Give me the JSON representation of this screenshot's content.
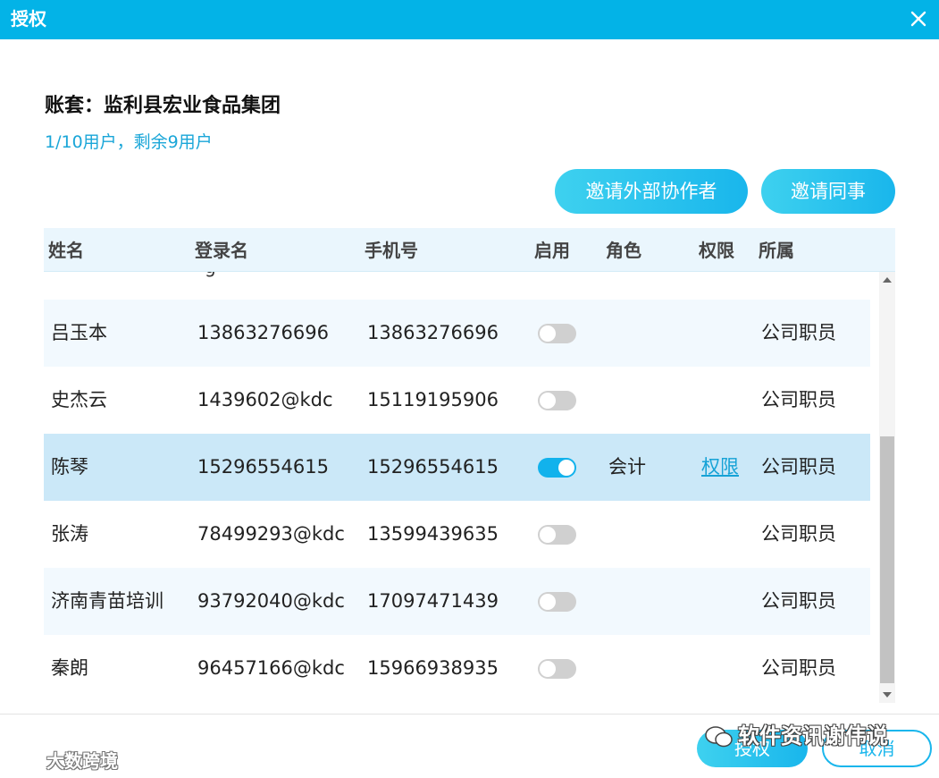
{
  "dialog": {
    "title": "授权"
  },
  "account": {
    "label": "账套：监利县宏业食品集团",
    "quota": "1/10用户，剩余9用户"
  },
  "buttons": {
    "invite_external": "邀请外部协作者",
    "invite_colleague": "邀请同事",
    "authorize": "授权",
    "cancel": "取消"
  },
  "table": {
    "columns": {
      "name": "姓名",
      "login": "登录名",
      "phone": "手机号",
      "enabled": "启用",
      "role": "角色",
      "permission": "权限",
      "org": "所属"
    },
    "partial_row_text": "g",
    "rows": [
      {
        "name": "吕玉本",
        "login": "13863276696",
        "phone": "13863276696",
        "enabled": false,
        "role": "",
        "permission": "",
        "org": "公司职员"
      },
      {
        "name": "史杰云",
        "login": "1439602@kdc",
        "phone": "15119195906",
        "enabled": false,
        "role": "",
        "permission": "",
        "org": "公司职员"
      },
      {
        "name": "陈琴",
        "login": "15296554615",
        "phone": "15296554615",
        "enabled": true,
        "role": "会计",
        "permission": "权限",
        "org": "公司职员"
      },
      {
        "name": "张涛",
        "login": "78499293@kdc",
        "phone": "13599439635",
        "enabled": false,
        "role": "",
        "permission": "",
        "org": "公司职员"
      },
      {
        "name": "济南青苗培训",
        "login": "93792040@kdc",
        "phone": "17097471439",
        "enabled": false,
        "role": "",
        "permission": "",
        "org": "公司职员"
      },
      {
        "name": "秦朗",
        "login": "96457166@kdc",
        "phone": "15966938935",
        "enabled": false,
        "role": "",
        "permission": "",
        "org": "公司职员"
      }
    ]
  },
  "watermarks": {
    "right": "软件资讯谢伟说",
    "left": "大数跨境"
  },
  "colors": {
    "accent": "#03b3e7",
    "link": "#16a2d6",
    "selected_row": "#cbe8f8",
    "alt_row": "#f2f9fe",
    "toggle_off": "#d0d0d0"
  }
}
